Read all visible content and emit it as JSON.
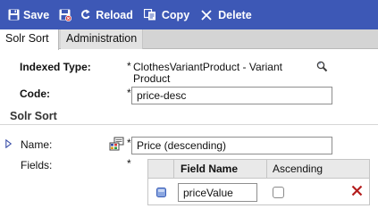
{
  "toolbar": {
    "save_label": "Save",
    "reload_label": "Reload",
    "copy_label": "Copy",
    "delete_label": "Delete",
    "background": "#3d58b6"
  },
  "tabs": [
    {
      "label": "Solr Sort",
      "active": true
    },
    {
      "label": "Administration",
      "active": false
    }
  ],
  "form": {
    "indexed_type_label": "Indexed Type:",
    "indexed_type_value_line1": "ClothesVariantProduct - Variant",
    "indexed_type_value_line2": "Product",
    "code_label": "Code:",
    "code_value": "price-desc",
    "required_marker": "*",
    "section_title": "Solr Sort",
    "name_label": "Name:",
    "name_value": "Price (descending)",
    "fields_label": "Fields:"
  },
  "fields_table": {
    "headers": [
      "",
      "Field Name",
      "Ascending"
    ],
    "rows": [
      {
        "field_name": "priceValue",
        "ascending": false
      }
    ]
  },
  "icons": {
    "save": "save-icon",
    "save_close": "save-and-close-icon",
    "reload": "reload-icon",
    "copy": "copy-icon",
    "delete": "delete-icon",
    "search": "search-icon",
    "expand": "expand-arrow-icon",
    "localize": "localize-icon",
    "row_select": "row-select-icon",
    "remove_row": "remove-row-icon"
  }
}
